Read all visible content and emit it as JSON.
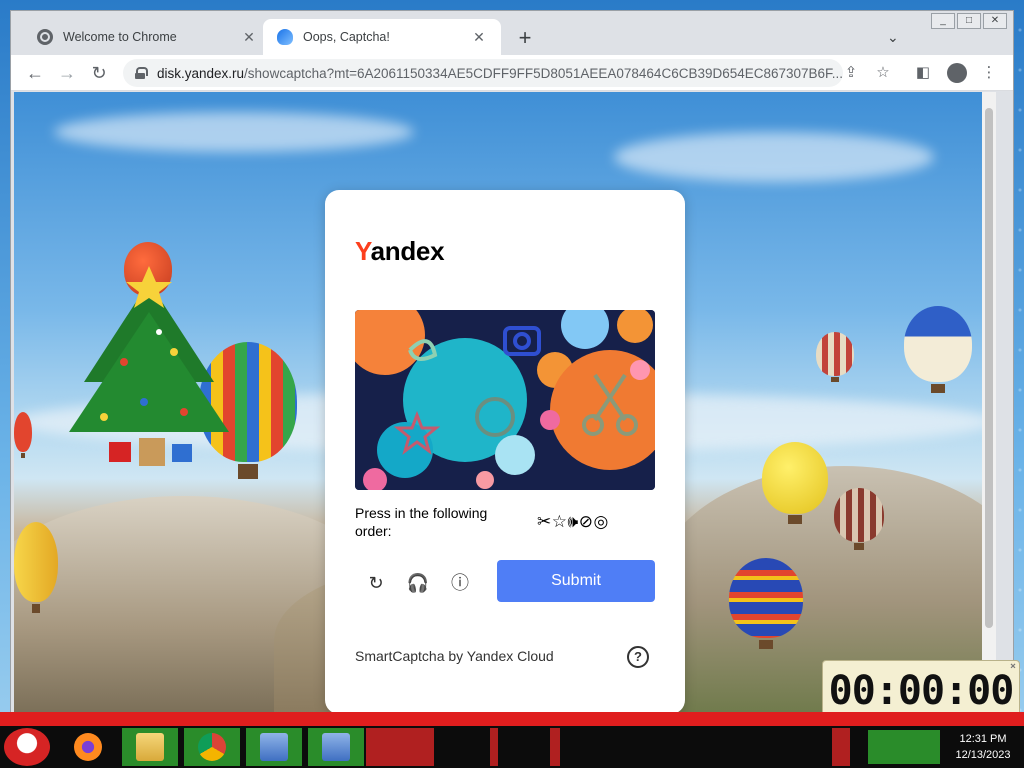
{
  "browser": {
    "tabs": [
      {
        "title": "Welcome to Chrome",
        "close": "✕"
      },
      {
        "title": "Oops, Captcha!",
        "close": "✕"
      }
    ],
    "new_tab": "+",
    "tab_search": "⌄",
    "url_host": "disk.yandex.ru",
    "url_path": "/showcaptcha?mt=6A2061150334AE5CDFF9FF5D8051AEEA078464C6CB39D654EC867307B6F...",
    "nav": {
      "back": "←",
      "forward": "→",
      "reload": "↻"
    },
    "toolbar_icons": {
      "share": "⇪",
      "bookmark": "☆",
      "side_panel": "◧",
      "menu": "⋮"
    }
  },
  "captcha": {
    "logo_y": "Y",
    "logo_rest": "andex",
    "prompt": "Press in the following order:",
    "order_icons": "✂☆🕪⊘◎",
    "controls": {
      "refresh": "↻",
      "audio": "🎧",
      "info": "ⓘ"
    },
    "submit_label": "Submit",
    "footer": "SmartCaptcha by Yandex Cloud",
    "help": "?"
  },
  "timer": {
    "value": "00:00:00",
    "close": "×"
  },
  "taskbar": {
    "clock_time": "12:31 PM",
    "clock_date": "12/13/2023"
  },
  "colors": {
    "accent": "#4f7ef6",
    "yandex_red": "#fc3f1d",
    "taskbar_green": "#2a8c2a",
    "taskbar_red": "#e01e1e"
  }
}
